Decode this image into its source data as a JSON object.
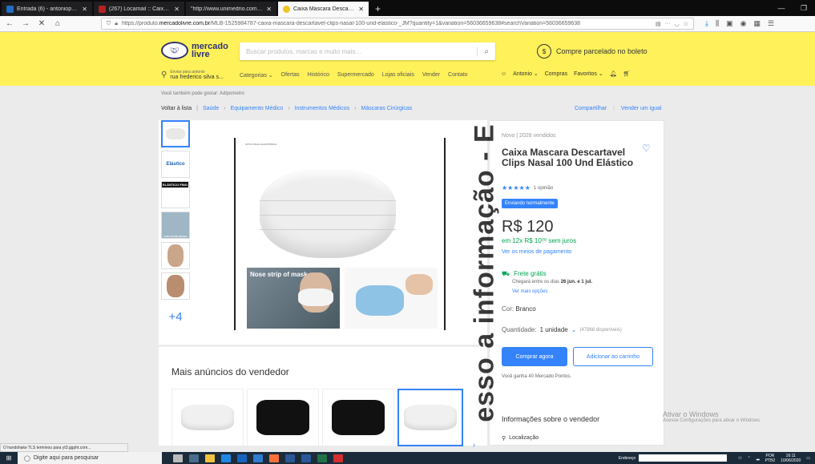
{
  "browser": {
    "tabs": [
      {
        "label": "Entrada (6) - antoniopanesi@h",
        "fav_color": "#1f6fc5",
        "active": false
      },
      {
        "label": "(267) Locamail :: Caixa de entra",
        "fav_color": "#b22222",
        "active": false
      },
      {
        "label": "\"http://www.unimedrio.com.br/in",
        "fav_color": "#1f1f21",
        "active": false
      },
      {
        "label": "Caixa Mascara Descartavel Clip",
        "fav_color": "#f0c420",
        "active": true
      }
    ],
    "url_prefix": "https://produto.",
    "url_domain": "mercadolivre.com.br",
    "url_rest": "/MLB-1525984787-caixa-mascara-descartavel-clips-nasal-100-und-elastico-_JM?quantity=1&variation=56036659638#searchVariation=56036659638"
  },
  "header": {
    "logo_line1": "mercado",
    "logo_line2": "livre",
    "search_placeholder": "Buscar produtos, marcas e muito mais…",
    "promo_text": "Compre parcelado no boleto",
    "address_line1": "Enviar para antonio",
    "address_line2": "rua frederico silva s...",
    "categories": [
      "Categorias ⌄",
      "Ofertas",
      "Histórico",
      "Supermercado",
      "Lojas oficiais",
      "Vender",
      "Contato"
    ],
    "user": "Antonio ⌄",
    "compras": "Compras",
    "favoritos": "Favoritos ⌄"
  },
  "page": {
    "also_liked": "Você também pode gostar: Adipometro",
    "back": "Voltar à lista",
    "breadcrumbs": [
      "Saúde",
      "Equipamento Médico",
      "Instrumentos Médicos",
      "Máscaras Cirúrgicas"
    ],
    "share": "Compartilhar",
    "sell_same": "Vender um igual",
    "thumb_labels": [
      "",
      "Elástico",
      "ELÁSTICO FINO",
      "CLIP ACOTE NASAL"
    ],
    "thumb_more": "+4",
    "image_caption": "NOTA FISCAL ELETRÔNICA",
    "image_strip_caption": "Nose strip of mask"
  },
  "product": {
    "condition": "Novo  |  2028 vendidos",
    "title": "Caixa Mascara Descartavel Clips Nasal 100 Und Elástico",
    "stars": "★★★★★",
    "opinions": "1 opinião",
    "badge": "Enviando normalmente",
    "price": "R$ 120",
    "installments": "em 12x R$ 10⁰⁰ sem juros",
    "payment_link": "Ver os meios de pagamento",
    "shipping": "Frete grátis",
    "arrival_prefix": "Chegará entre os dias",
    "arrival_dates": "26 jun. e 1 jul.",
    "more_options": "Ver mais opções",
    "color_label": "Cor:",
    "color_value": "Branco",
    "qty_label": "Quantidade:",
    "qty_value": "1 unidade",
    "qty_available": "(47968 disponíveis)",
    "buy_now": "Comprar agora",
    "add_cart": "Adicionar ao carrinho",
    "points": "Você ganha 40 Mercado Pontos.",
    "seller_heading": "Informações sobre o vendedor",
    "location": "Localização"
  },
  "more": {
    "heading": "Mais anúncios do vendedor"
  },
  "overlay": {
    "watermark": "esso a informação - E",
    "activate_title": "Ativar o Windows",
    "activate_sub": "Acesse Configurações para ativar o Windows."
  },
  "status": {
    "text": "O handshake TLS terminou para yt3.ggpht.com..."
  },
  "taskbar": {
    "search": "Digite aqui para pesquisar",
    "address_label": "Endereço",
    "lang1": "POR",
    "lang2": "PTB2",
    "time": "16:11",
    "date": "10/06/2020"
  },
  "colors": {
    "ml_yellow": "#fff159",
    "ml_blue": "#3483fa",
    "ml_green": "#00a650",
    "taskbar": "#1b2b3a"
  }
}
